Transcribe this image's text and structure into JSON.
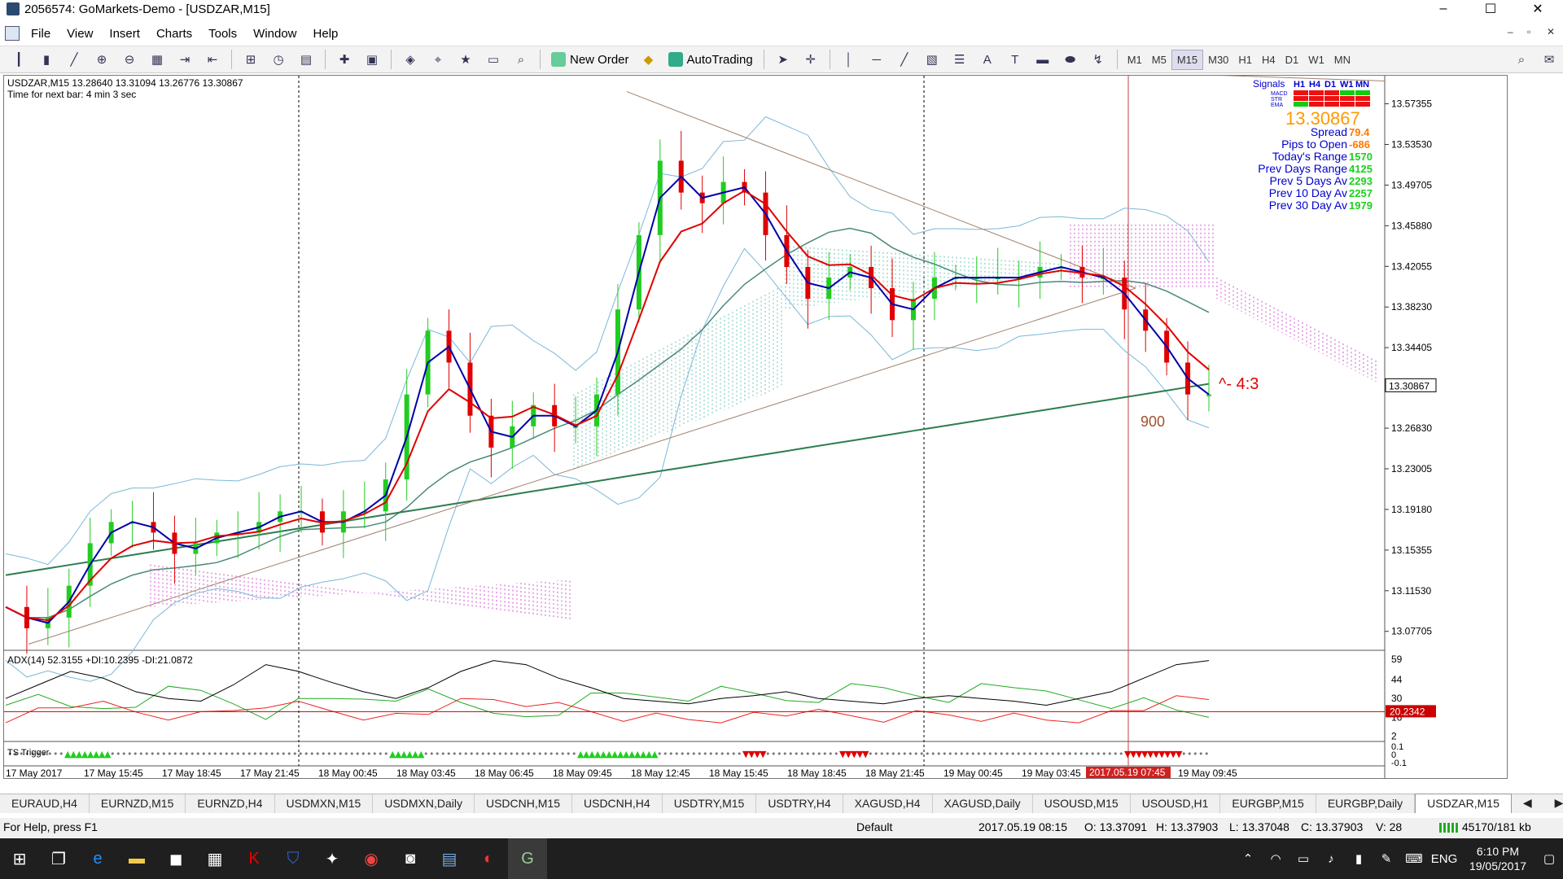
{
  "window": {
    "title": "2056574: GoMarkets-Demo - [USDZAR,M15]",
    "minimize": "–",
    "maximize": "☐",
    "close": "✕"
  },
  "menu": [
    "File",
    "View",
    "Insert",
    "Charts",
    "Tools",
    "Window",
    "Help"
  ],
  "toolbar": {
    "new_order": "New Order",
    "autotrading": "AutoTrading",
    "timeframes": [
      "M1",
      "M5",
      "M15",
      "M30",
      "H1",
      "H4",
      "D1",
      "W1",
      "MN"
    ],
    "active_timeframe": "M15"
  },
  "chart": {
    "header": "USDZAR,M15  13.28640 13.31094 13.26776 13.30867",
    "timer": "Time for next bar: 4 min 3 sec",
    "current_price": "13.30867",
    "annotation_ratio": "^- 4:3",
    "annotation_900": "900",
    "crosshair_time": "2017.05.19 07:45",
    "indicator_header": "ADX(14) 52.3155 +DI:10.2395 -DI:21.0872",
    "adx_value_label": "20.2342",
    "trigger_label": "TS Trigger",
    "signals_panel": {
      "signals": "Signals",
      "tfs": [
        "H1",
        "H4",
        "D1",
        "W1",
        "MN"
      ],
      "rows": [
        "MACD",
        "STR",
        "EMA"
      ],
      "price": "13.30867",
      "lines": [
        {
          "label": "Spread",
          "value": "79.4"
        },
        {
          "label": "Pips to Open",
          "value": "-686"
        },
        {
          "label": "Today's Range",
          "value": "1570"
        },
        {
          "label": "Prev Days Range",
          "value": "4125"
        },
        {
          "label": "Prev 5 Days Av",
          "value": "2293"
        },
        {
          "label": "Prev 10 Day Av",
          "value": "2257"
        },
        {
          "label": "Prev 30 Day Av",
          "value": "1979"
        }
      ]
    },
    "colors": {
      "bull": "#22cc22",
      "bear": "#e00000",
      "ma_fast": "#e00000",
      "ma_blue": "#0000aa",
      "ma_200": "#2e7d4f",
      "ma_50": "#4a8a7a",
      "bb": "#7ab8d8",
      "cloud_up": "#5fbfb0",
      "cloud_dn": "#cc44cc",
      "trend": "#a0826d",
      "crosshair": "#c04040"
    }
  },
  "chart_data": {
    "type": "candlestick",
    "symbol": "USDZAR",
    "timeframe": "M15",
    "ylim": [
      13.06,
      13.6
    ],
    "y_ticks": [
      "13.57355",
      "13.53530",
      "13.49705",
      "13.45880",
      "13.42055",
      "13.38230",
      "13.34405",
      "13.30867",
      "13.26830",
      "13.23005",
      "13.19180",
      "13.15355",
      "13.11530",
      "13.07705"
    ],
    "x_ticks": [
      "17 May 2017",
      "17 May 15:45",
      "17 May 18:45",
      "17 May 21:45",
      "18 May 00:45",
      "18 May 03:45",
      "18 May 06:45",
      "18 May 09:45",
      "18 May 12:45",
      "18 May 15:45",
      "18 May 18:45",
      "18 May 21:45",
      "19 May 00:45",
      "19 May 03:45",
      "19 May 09:45"
    ],
    "close_path": [
      13.1,
      13.08,
      13.09,
      13.12,
      13.16,
      13.18,
      13.18,
      13.17,
      13.15,
      13.16,
      13.17,
      13.17,
      13.18,
      13.19,
      13.19,
      13.17,
      13.19,
      13.19,
      13.22,
      13.3,
      13.36,
      13.33,
      13.28,
      13.25,
      13.27,
      13.29,
      13.27,
      13.27,
      13.3,
      13.38,
      13.45,
      13.52,
      13.49,
      13.48,
      13.5,
      13.49,
      13.45,
      13.42,
      13.39,
      13.41,
      13.42,
      13.4,
      13.37,
      13.39,
      13.41,
      13.41,
      13.41,
      13.41,
      13.41,
      13.42,
      13.42,
      13.41,
      13.41,
      13.38,
      13.36,
      13.33,
      13.3,
      13.3
    ],
    "adx_ticks": [
      "59",
      "44",
      "30",
      "16",
      "2"
    ],
    "adx_values": [
      30,
      40,
      50,
      45,
      35,
      30,
      28,
      40,
      55,
      50,
      42,
      35,
      30,
      38,
      50,
      58,
      55,
      45,
      38,
      30,
      28,
      26,
      30,
      32,
      35,
      30,
      28,
      26,
      30,
      32,
      30,
      28,
      25,
      30,
      35,
      45,
      55,
      58
    ]
  }
}
